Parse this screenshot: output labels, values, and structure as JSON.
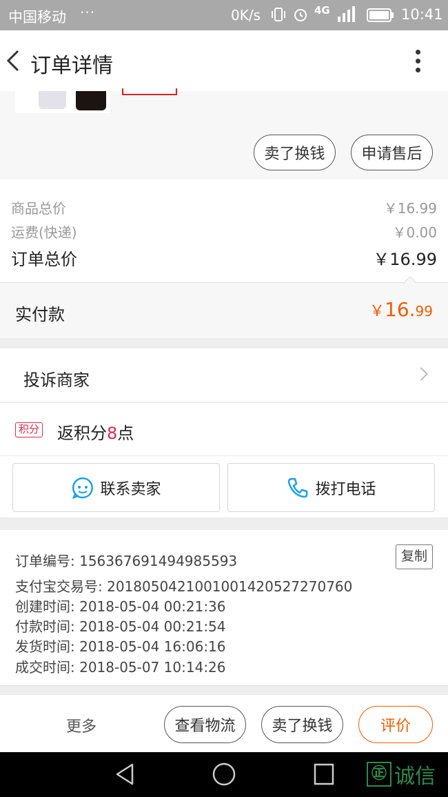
{
  "status_bar": {
    "carrier": "中国移动",
    "dots": "···",
    "speed": "0K/s",
    "network": "4G",
    "time": "10:41"
  },
  "header": {
    "title": "订单详情"
  },
  "product_actions": {
    "sell_label": "卖了换钱",
    "aftersale_label": "申请售后"
  },
  "price_summary": {
    "goods_total_label": "商品总价",
    "goods_total_value": "￥16.99",
    "shipping_label": "运费(快递)",
    "shipping_value": "￥0.00",
    "order_total_label": "订单总价",
    "order_total_value": "￥16.99",
    "paid_label": "实付款",
    "paid_currency": "￥",
    "paid_integer": "16.",
    "paid_decimal": "99"
  },
  "complaint": {
    "label": "投诉商家"
  },
  "points": {
    "badge": "积分",
    "prefix": "返积分",
    "amount": "8",
    "suffix": "点"
  },
  "contact": {
    "seller_label": "联系卖家",
    "phone_label": "拨打电话"
  },
  "order_info": {
    "order_no": "订单编号: 156367691494985593",
    "copy_label": "复制",
    "alipay_no": "支付宝交易号: 2018050421001001420527270760",
    "created": "创建时间: 2018-05-04 00:21:36",
    "paid": "付款时间: 2018-05-04 00:21:54",
    "shipped": "发货时间: 2018-05-04 16:06:16",
    "completed": "成交时间: 2018-05-07 10:14:26"
  },
  "bottom_bar": {
    "more_label": "更多",
    "logistics_label": "查看物流",
    "sell_label": "卖了换钱",
    "review_label": "评价"
  },
  "watermark": {
    "logo_char": "㊣",
    "text": "诚信"
  },
  "colors": {
    "accent": "#f25d00",
    "points": "#e02a4a",
    "status_bar": "#a9a9a9"
  }
}
